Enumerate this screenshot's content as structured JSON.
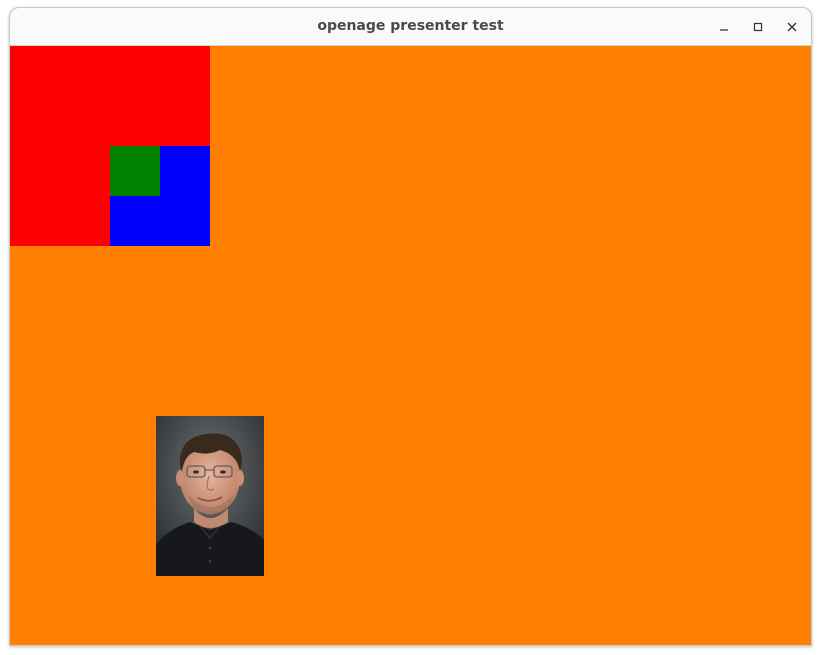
{
  "window": {
    "title": "openage presenter test",
    "controls": {
      "minimize": "minimize-icon",
      "maximize": "maximize-icon",
      "close": "close-icon"
    }
  },
  "scene": {
    "background_color": "#ff8000",
    "rects": [
      {
        "name": "red-square",
        "color": "#ff0000"
      },
      {
        "name": "blue-square",
        "color": "#0000ff"
      },
      {
        "name": "green-square",
        "color": "#008000"
      }
    ],
    "sprite": {
      "name": "portrait-photo"
    }
  }
}
